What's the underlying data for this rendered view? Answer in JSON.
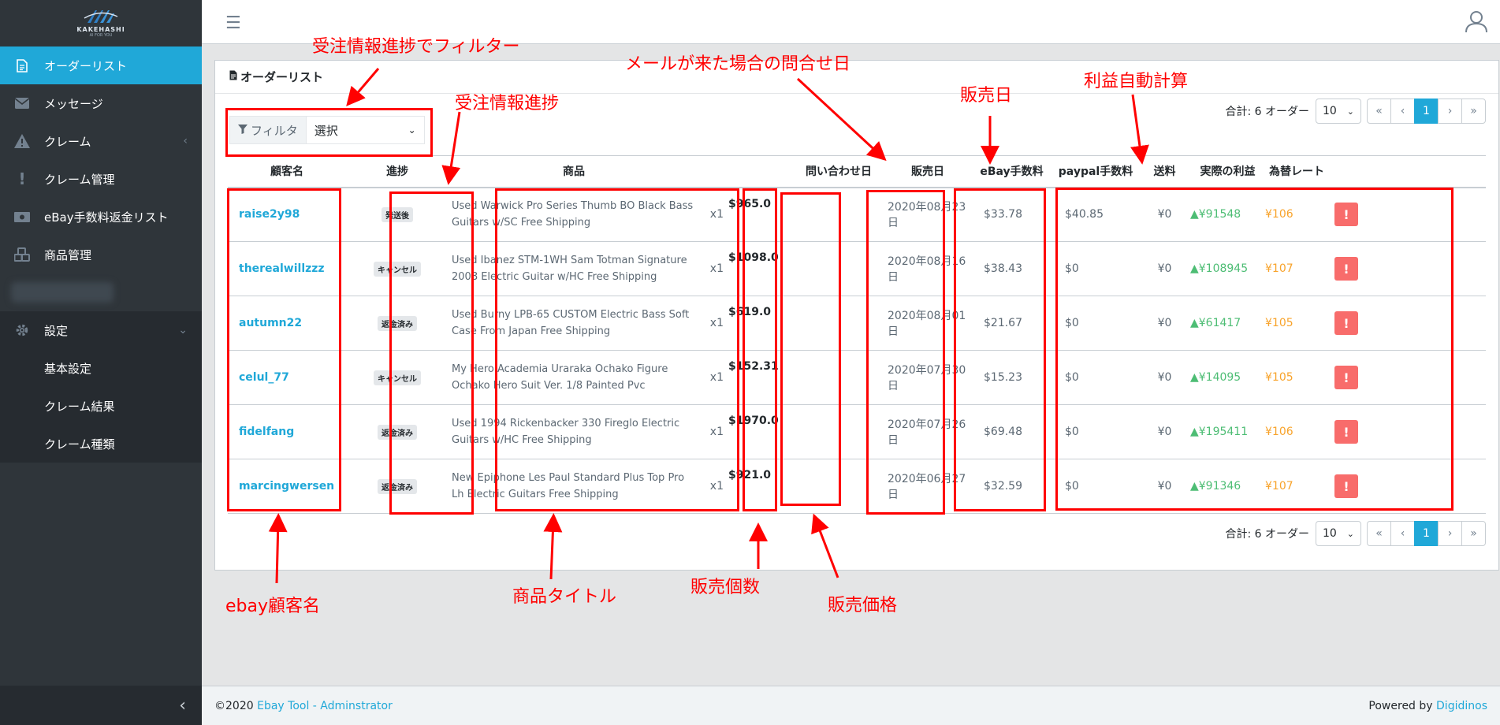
{
  "brand": {
    "name": "KAKEHASHI",
    "tagline": "AI FOR YOU"
  },
  "sidebar": {
    "items": [
      {
        "label": "オーダーリスト",
        "icon": "document-icon"
      },
      {
        "label": "メッセージ",
        "icon": "envelope-icon"
      },
      {
        "label": "クレーム",
        "icon": "warning-icon"
      },
      {
        "label": "クレーム管理",
        "icon": "exclamation-icon"
      },
      {
        "label": "eBay手数料返金リスト",
        "icon": "money-icon"
      },
      {
        "label": "商品管理",
        "icon": "cubes-icon"
      }
    ],
    "settings": {
      "label": "設定",
      "icon": "gear-icon"
    },
    "children": [
      "基本設定",
      "クレーム結果",
      "クレーム種類"
    ]
  },
  "card": {
    "title": "オーダーリスト"
  },
  "filter": {
    "label": "フィルタ",
    "selected": "選択"
  },
  "pager": {
    "total": "合計: 6 オーダー",
    "page_size": "10",
    "first": "«",
    "prev": "‹",
    "current": "1",
    "next": "›",
    "last": "»"
  },
  "table": {
    "headers": [
      "顧客名",
      "進捗",
      "商品",
      "",
      "",
      "問い合わせ日",
      "販売日",
      "eBay手数料",
      "paypal手数料",
      "送料",
      "実際の利益",
      "為替レート",
      ""
    ],
    "rows": [
      {
        "customer": "raise2y98",
        "status": "発送後",
        "product": "Used Warwick Pro Series Thumb BO Black Bass Guitars w/SC Free Shipping",
        "qty": "x1",
        "price": "$965.0",
        "inquiry": "",
        "sale_date": "2020年08月23日",
        "ebay_fee": "$33.78",
        "paypal_fee": "$40.85",
        "shipping": "¥0",
        "profit": "▲¥91548",
        "rate": "¥106"
      },
      {
        "customer": "therealwillzzz",
        "status": "キャンセル",
        "product": "Used Ibanez STM-1WH Sam Totman Signature 2008 Electric Guitar w/HC Free Shipping",
        "qty": "x1",
        "price": "$1098.0",
        "inquiry": "",
        "sale_date": "2020年08月16日",
        "ebay_fee": "$38.43",
        "paypal_fee": "$0",
        "shipping": "¥0",
        "profit": "▲¥108945",
        "rate": "¥107"
      },
      {
        "customer": "autumn22",
        "status": "返金済み",
        "product": "Used Burny LPB-65 CUSTOM Electric Bass Soft Case From Japan Free Shipping",
        "qty": "x1",
        "price": "$619.0",
        "inquiry": "",
        "sale_date": "2020年08月01日",
        "ebay_fee": "$21.67",
        "paypal_fee": "$0",
        "shipping": "¥0",
        "profit": "▲¥61417",
        "rate": "¥105"
      },
      {
        "customer": "celul_77",
        "status": "キャンセル",
        "product": "My Hero Academia Uraraka Ochako Figure Ochako Hero Suit Ver. 1/8 Painted Pvc",
        "qty": "x1",
        "price": "$152.31",
        "inquiry": "",
        "sale_date": "2020年07月30日",
        "ebay_fee": "$15.23",
        "paypal_fee": "$0",
        "shipping": "¥0",
        "profit": "▲¥14095",
        "rate": "¥105"
      },
      {
        "customer": "fidelfang",
        "status": "返金済み",
        "product": "Used 1994 Rickenbacker 330 Fireglo Electric Guitars w/HC Free Shipping",
        "qty": "x1",
        "price": "$1970.0",
        "inquiry": "",
        "sale_date": "2020年07月26日",
        "ebay_fee": "$69.48",
        "paypal_fee": "$0",
        "shipping": "¥0",
        "profit": "▲¥195411",
        "rate": "¥106"
      },
      {
        "customer": "marcingwersen",
        "status": "返金済み",
        "product": "New Epiphone Les Paul Standard Plus Top Pro Lh Electric Guitars Free Shipping",
        "qty": "x1",
        "price": "$921.0",
        "inquiry": "",
        "sale_date": "2020年06月27日",
        "ebay_fee": "$32.59",
        "paypal_fee": "$0",
        "shipping": "¥0",
        "profit": "▲¥91346",
        "rate": "¥107"
      }
    ],
    "action_label": "!"
  },
  "footer": {
    "copyright": "©2020",
    "app_link": "Ebay Tool - Adminstrator",
    "powered_by": "Powered by",
    "powered_link": "Digidinos"
  },
  "annotations": {
    "filter_note": "受注情報進捗でフィルター",
    "status_note": "受注情報進捗",
    "inquiry_note": "メールが来た場合の問合せ日",
    "sale_date_note": "販売日",
    "profit_note": "利益自動計算",
    "customer_note": "ebay顧客名",
    "product_note": "商品タイトル",
    "qty_note": "販売個数",
    "price_note": "販売価格"
  },
  "colors": {
    "primary": "#20a8d8",
    "sidebar": "#2f353a",
    "danger": "#f86c6b",
    "success": "#4dbd74",
    "warning": "#f8a32b",
    "annotation": "#ff0000"
  }
}
